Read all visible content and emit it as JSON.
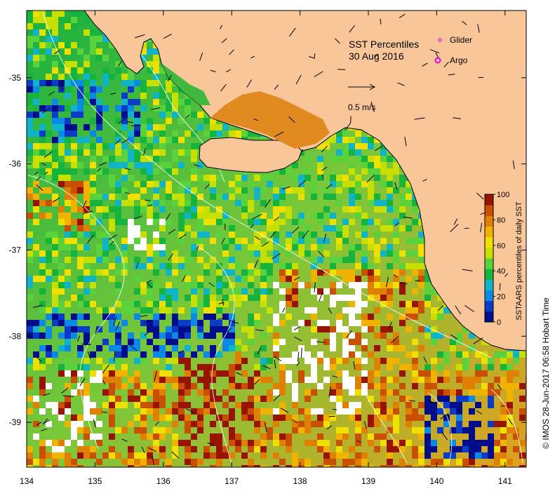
{
  "map": {
    "title_line1": "SST Percentiles",
    "title_line2": "30 Aug 2016",
    "scale_label": "0.5 m/s",
    "legend": [
      {
        "label": "Glider",
        "color": "#e000e0",
        "symbol": "plus"
      },
      {
        "label": "Argo",
        "color": "#e000e0",
        "symbol": "circle"
      }
    ],
    "colorbar": {
      "label": "SSTAARS percentiles of daily SST",
      "ticks": [
        "0",
        "20",
        "40",
        "60",
        "80",
        "100"
      ],
      "colors": [
        "#000e8c",
        "#0a3cc8",
        "#0a8ae6",
        "#10b4c8",
        "#16b43c",
        "#5ad23c",
        "#c8e000",
        "#f0e000",
        "#f0b400",
        "#e08000",
        "#c85000",
        "#961400"
      ]
    },
    "x_axis": {
      "ticks": [
        "134",
        "135",
        "136",
        "137",
        "138",
        "139",
        "140",
        "141"
      ]
    },
    "y_axis": {
      "ticks": [
        "-35",
        "-36",
        "-37",
        "-38",
        "-39"
      ]
    },
    "copyright": "© IMOS 28-Jun-2017 06:58 Hobart Time",
    "colors": {
      "land": "#f9c69a",
      "coast": "#000000",
      "contour": "#ffffff",
      "vector": "#000000"
    }
  }
}
